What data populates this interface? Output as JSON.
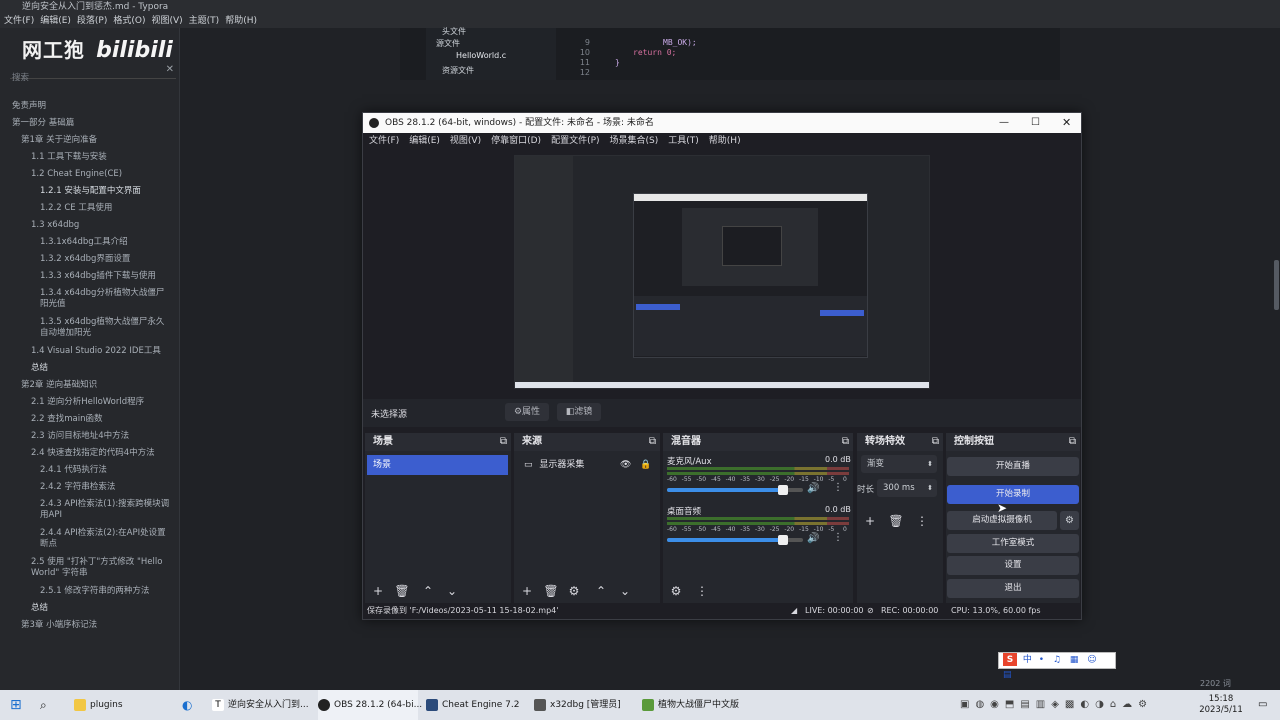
{
  "typora": {
    "title": "逆向安全从入门到惩杰.md - Typora",
    "menu": [
      "文件(F)",
      "编辑(E)",
      "段落(P)",
      "格式(O)",
      "视图(V)",
      "主题(T)",
      "帮助(H)"
    ],
    "search_placeholder": "搜索",
    "toc": [
      "免责声明",
      "第一部分 基础篇",
      "第1章 关于逆向准备",
      "1.1 工具下载与安装",
      "1.2 Cheat Engine(CE)",
      "1.2.1 安装与配置中文界面",
      "1.2.2 CE 工具使用",
      "1.3 x64dbg",
      "1.3.1x64dbg工具介绍",
      "1.3.2 x64dbg界面设置",
      "1.3.3 x64dbg插件下载与使用",
      "1.3.4 x64dbg分析植物大战僵尸阳光值",
      "1.3.5 x64dbg植物大战僵尸永久自动增加阳光",
      "1.4 Visual Studio 2022 IDE工具",
      "总结",
      "第2章 逆向基础知识",
      "2.1 逆向分析HelloWorld程序",
      "2.2 查找main函数",
      "2.3 访问目标地址4中方法",
      "2.4 快速查找指定的代码4中方法",
      "2.4.1 代码执行法",
      "2.4.2 字符串检索法",
      "2.4.3 API检索法(1):搜索跨模块调用API",
      "2.4.4 API检索法(2):在API处设置断点",
      "2.5 使用 \"打补丁\"方式修改 \"Hello World\" 字符串",
      "2.5.1 修改字符串的两种方法",
      "总结",
      "第3章 小端序标记法"
    ],
    "footer_status": "2202 词"
  },
  "code": {
    "tree": [
      "头文件",
      "源文件",
      "HelloWorld.c",
      "资源文件"
    ],
    "line_numbers": [
      "9",
      "10",
      "11",
      "12"
    ],
    "lines": [
      "MB_OK);",
      "",
      "return 0;",
      "}"
    ]
  },
  "watermark": {
    "text": "网工狍",
    "logo": "bilibili"
  },
  "obs": {
    "title": "OBS 28.1.2 (64-bit, windows) - 配置文件: 未命名 - 场景: 未命名",
    "menu": [
      "文件(F)",
      "编辑(E)",
      "视图(V)",
      "停靠窗口(D)",
      "配置文件(P)",
      "场景集合(S)",
      "工具(T)",
      "帮助(H)"
    ],
    "source_bar": {
      "label": "未选择源",
      "properties": "属性",
      "filters": "滤镜"
    },
    "docks": {
      "scenes": {
        "title": "场景",
        "items": [
          "场景"
        ]
      },
      "sources": {
        "title": "来源",
        "items": [
          "显示器采集"
        ]
      },
      "mixer": {
        "title": "混音器",
        "channels": [
          {
            "name": "麦克风/Aux",
            "db": "0.0 dB",
            "volume": 0.85
          },
          {
            "name": "桌面音频",
            "db": "0.0 dB",
            "volume": 0.85
          }
        ],
        "ticks": [
          "-60",
          "-55",
          "-50",
          "-45",
          "-40",
          "-35",
          "-30",
          "-25",
          "-20",
          "-15",
          "-10",
          "-5",
          "0"
        ]
      },
      "transitions": {
        "title": "转场特效",
        "type": "渐变",
        "duration_label": "时长",
        "duration": "300 ms"
      },
      "controls": {
        "title": "控制按钮",
        "start_stream": "开始直播",
        "start_record": "开始录制",
        "virtual_camera": "启动虚拟摄像机",
        "studio_mode": "工作室模式",
        "settings": "设置",
        "exit": "退出"
      }
    },
    "status": {
      "recording_saved": "保存录像到 'F:/Videos/2023-05-11 15-18-02.mp4'",
      "live": "LIVE: 00:00:00",
      "rec": "REC: 00:00:00",
      "cpu": "CPU: 13.0%, 60.00 fps"
    },
    "accent": "#3c5ecf"
  },
  "ime": {
    "label": "中"
  },
  "taskbar": {
    "tasks": [
      {
        "label": "plugins"
      },
      {
        "label": "逆向安全从入门到..."
      },
      {
        "label": "OBS 28.1.2 (64-bi..."
      },
      {
        "label": "Cheat Engine 7.2"
      },
      {
        "label": "x32dbg [管理员]"
      },
      {
        "label": "植物大战僵尸中文版"
      }
    ],
    "time": "15:18",
    "date": "2023/5/11"
  }
}
